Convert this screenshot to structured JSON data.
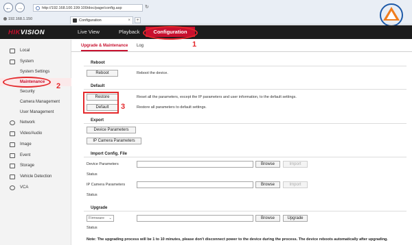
{
  "browser": {
    "back_icon": "back-arrow-icon",
    "forward_icon": "forward-arrow-icon",
    "url": "http://192.168.100.199:100/doc/page/config.asp",
    "tab_title": "Configuration",
    "ip_label": "192.168.1.150",
    "close_glyph": "×",
    "newtab_glyph": "+"
  },
  "brand": {
    "name": "DAMAONG",
    "sub": "TRADING"
  },
  "header": {
    "logo_red": "HIK",
    "logo_white": "VISION",
    "nav": [
      "Live View",
      "Playback",
      "Configuration"
    ]
  },
  "annotations": {
    "one": "1",
    "two": "2",
    "three": "3"
  },
  "sidebar": {
    "items": [
      {
        "label": "Local",
        "icon": "monitor-icon"
      },
      {
        "label": "System",
        "icon": "system-icon"
      },
      {
        "label": "System Settings"
      },
      {
        "label": "Maintenance"
      },
      {
        "label": "Security"
      },
      {
        "label": "Camera Management"
      },
      {
        "label": "User Management"
      },
      {
        "label": "Network",
        "icon": "globe-icon"
      },
      {
        "label": "Video/Audio",
        "icon": "camera-icon"
      },
      {
        "label": "Image",
        "icon": "image-icon"
      },
      {
        "label": "Event",
        "icon": "calendar-icon"
      },
      {
        "label": "Storage",
        "icon": "storage-icon"
      },
      {
        "label": "Vehicle Detection",
        "icon": "vehicle-icon"
      },
      {
        "label": "VCA",
        "icon": "vca-icon"
      }
    ]
  },
  "tabs": [
    "Upgrade & Maintenance",
    "Log"
  ],
  "reboot": {
    "title": "Reboot",
    "button": "Reboot",
    "desc": "Reboot the device."
  },
  "default": {
    "title": "Default",
    "restore_button": "Restore",
    "restore_desc": "Reset all the parameters, except the IP parameters and user information, to the default settings.",
    "default_button": "Default",
    "default_desc": "Restore all parameters to default settings."
  },
  "export": {
    "title": "Export",
    "device_button": "Device Parameters",
    "ipcam_button": "IP Camera Parameters"
  },
  "import": {
    "title": "Import Config. File",
    "device_label": "Device Parameters",
    "ipcam_label": "IP Camera Parameters",
    "status_label": "Status",
    "browse": "Browse",
    "import": "Import"
  },
  "upgrade": {
    "title": "Upgrade",
    "select_value": "Firmware",
    "browse": "Browse",
    "button": "Upgrade",
    "status_label": "Status"
  },
  "note": "Note: The upgrading process will be 1 to 10 minutes, please don't disconnect power to the device during the process. The device reboots automatically after upgrading.",
  "colors": {
    "accent": "#c8102e",
    "annotation": "#e4282b",
    "topbar": "#1c1c1c"
  }
}
